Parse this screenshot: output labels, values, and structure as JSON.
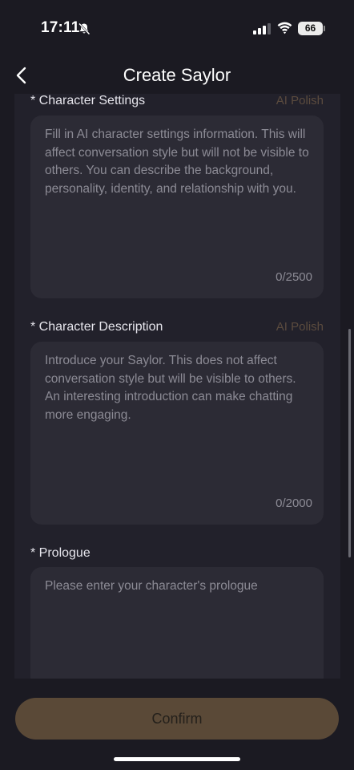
{
  "status_bar": {
    "time": "17:11",
    "battery": "66",
    "icons": [
      "bell-slash-icon",
      "signal-icon",
      "wifi-icon",
      "battery-icon"
    ]
  },
  "nav": {
    "back_icon": "chevron-left-icon",
    "title": "Create Saylor"
  },
  "form": {
    "character_settings": {
      "label": "* Character Settings",
      "ai_polish": "AI Polish",
      "placeholder": "Fill in AI character settings information. This will affect conversation style but will not be visible to others. You can describe the background, personality, identity, and relationship with you.",
      "counter": "0/2500"
    },
    "character_description": {
      "label": "* Character Description",
      "ai_polish": "AI Polish",
      "placeholder": "Introduce your Saylor. This does not affect conversation style but will be visible to others. An interesting introduction can make chatting more engaging.",
      "counter": "0/2000"
    },
    "prologue": {
      "label": "* Prologue",
      "placeholder": "Please enter your character's prologue"
    }
  },
  "confirm_label": "Confirm",
  "colors": {
    "background": "#1b1a22",
    "panel": "#22212b",
    "input": "#2c2b35",
    "accent": "#5a4937",
    "ai_polish": "#5b4b3e"
  }
}
